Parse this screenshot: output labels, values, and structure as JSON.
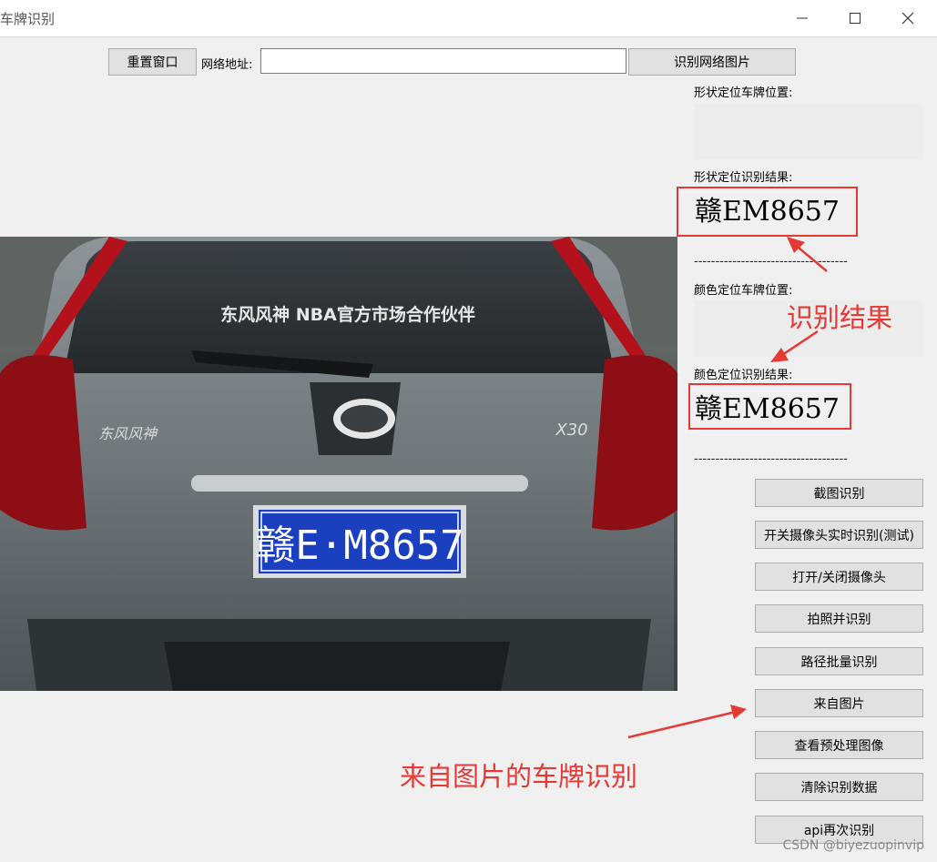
{
  "window": {
    "title": "车牌识别"
  },
  "toolbar": {
    "reset_label": "重置窗口",
    "url_label": "网络地址:",
    "url_value": "",
    "recognize_url_label": "识别网络图片"
  },
  "results": {
    "shape_position_label": "形状定位车牌位置:",
    "shape_result_label": "形状定位识别结果:",
    "shape_result_value": "赣EM8657",
    "divider": "------------------------------------",
    "color_position_label": "颜色定位车牌位置:",
    "color_result_label": "颜色定位识别结果:",
    "color_result_value": "赣EM8657"
  },
  "actions": [
    {
      "name": "screenshot-recognize-button",
      "label": "截图识别"
    },
    {
      "name": "camera-realtime-button",
      "label": "开关摄像头实时识别(测试)"
    },
    {
      "name": "toggle-camera-button",
      "label": "打开/关闭摄像头"
    },
    {
      "name": "capture-recognize-button",
      "label": "拍照并识别"
    },
    {
      "name": "batch-path-button",
      "label": "路径批量识别"
    },
    {
      "name": "from-image-button",
      "label": "来自图片"
    },
    {
      "name": "view-preprocess-button",
      "label": "查看预处理图像"
    },
    {
      "name": "clear-data-button",
      "label": "清除识别数据"
    },
    {
      "name": "api-recognize-button",
      "label": "api再次识别"
    }
  ],
  "annotations": {
    "result_note": "识别结果",
    "source_note": "来自图片的车牌识别"
  },
  "photo": {
    "window_text": "东风风神 NBA官方市场合作伙伴",
    "badge_left": "东风风神",
    "badge_right": "X30",
    "plate_text": "赣E·M8657"
  },
  "watermark": "CSDN @biyezuopinvip",
  "colors": {
    "accent_red": "#e53935",
    "plate_blue": "#1a3fbf"
  }
}
